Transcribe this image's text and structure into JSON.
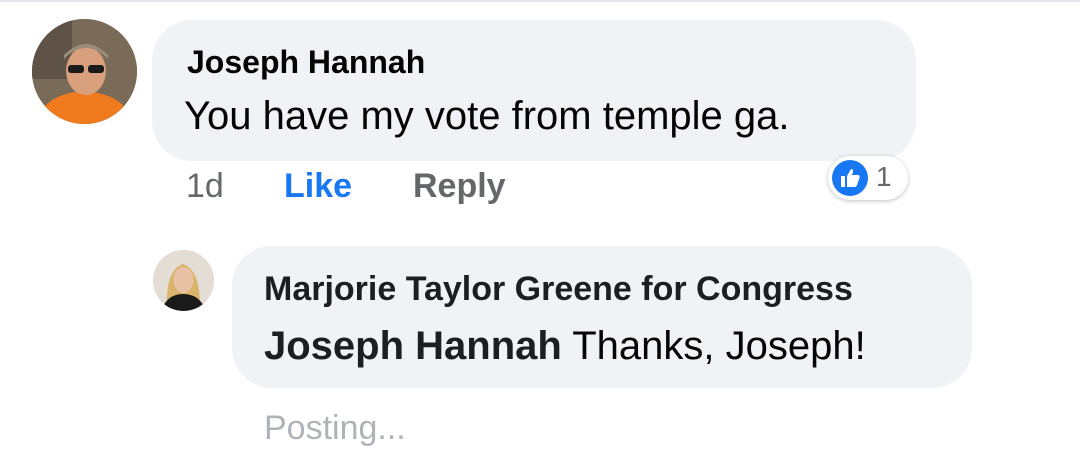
{
  "comment": {
    "author": "Joseph Hannah",
    "text": "You have my vote from temple ga.",
    "time": "1d",
    "like_label": "Like",
    "reply_label": "Reply",
    "reactions": {
      "icon": "like-icon",
      "count": "1",
      "color": "#1877f2"
    }
  },
  "reply": {
    "author": "Marjorie Taylor Greene for Congress",
    "mention": "Joseph Hannah",
    "text": "Thanks, Joseph!",
    "status": "Posting..."
  }
}
